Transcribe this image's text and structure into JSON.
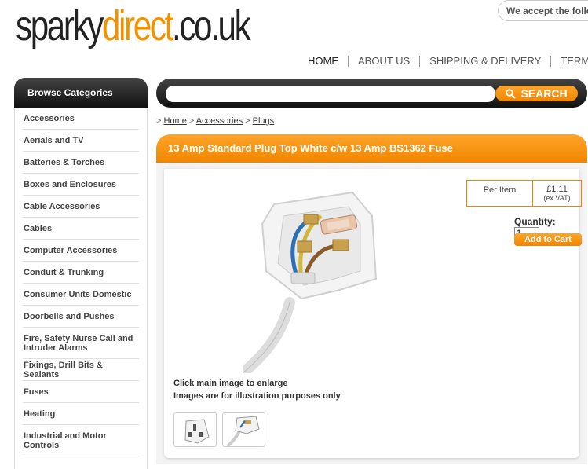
{
  "logo": {
    "part1": "sparky",
    "part2": "direct",
    "part3": ".co.uk"
  },
  "accept_text": "We accept the follo",
  "nav": [
    "HOME",
    "ABOUT US",
    "SHIPPING & DELIVERY",
    "TERM"
  ],
  "categories_title": "Browse Categories",
  "categories": [
    "Accessories",
    "Aerials and TV",
    "Batteries & Torches",
    "Boxes and Enclosures",
    "Cable Accessories",
    "Cables",
    "Computer Accessories",
    "Conduit & Trunking",
    "Consumer Units Domestic",
    "Doorbells and Pushes",
    "Fire, Safety Nurse Call and Intruder Alarms",
    "Fixings, Drill Bits & Sealants",
    "Fuses",
    "Heating",
    "Industrial and Motor Controls"
  ],
  "search": {
    "button": "SEARCH",
    "placeholder": ""
  },
  "breadcrumb": {
    "sep": ">",
    "items": [
      "Home",
      "Accessories",
      "Plugs"
    ]
  },
  "product": {
    "title": "13 Amp Standard Plug Top White c/w 13 Amp BS1362 Fuse",
    "price_label": "Per Item",
    "price": "£1.11",
    "price_note": "(ex VAT)",
    "qty_label": "Quantity:",
    "qty_value": "1",
    "add_to_cart": "Add to Cart",
    "caption1": "Click main image to enlarge",
    "caption2": "Images are for illustration purposes only"
  },
  "colors": {
    "accent": "#f08600",
    "dark": "#111111"
  },
  "icons": {
    "search": "search-icon"
  }
}
